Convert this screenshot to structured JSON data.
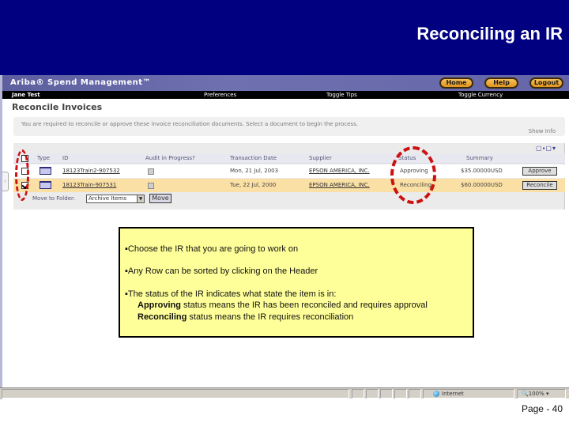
{
  "slide": {
    "title": "Reconciling an IR",
    "page_label": "Page - 40"
  },
  "app": {
    "brand": "Ariba® Spend Management™",
    "nav_buttons": [
      "Home",
      "Help",
      "Logout"
    ],
    "user": "Jane Test",
    "links": [
      "Preferences",
      "Toggle Tips",
      "Toggle Currency"
    ]
  },
  "page": {
    "title": "Reconcile Invoices",
    "message": "You are required to reconcile or approve these invoice reconciliation documents. Select a document to begin the process.",
    "show_link": "Show Info"
  },
  "table": {
    "tools": "▢▪▢▾",
    "headers": [
      "Type",
      "ID",
      "Audit in Progress?",
      "Transaction Date",
      "Supplier",
      "Status",
      "Summary"
    ],
    "rows": [
      {
        "checked": false,
        "id": "18123Train2-907532",
        "audit": false,
        "date": "Mon, 21 Jul, 2003",
        "supplier": "EPSON AMERICA, INC.",
        "status": "Approving",
        "summary": "$35.00000USD",
        "action": "Approve"
      },
      {
        "checked": true,
        "id": "18123Train-907531",
        "audit": false,
        "date": "Tue, 22 Jul, 2000",
        "supplier": "EPSON AMERICA, INC.",
        "status": "Reconciling",
        "summary": "$60.00000USD",
        "action": "Reconcile"
      }
    ],
    "move_label": "Move to Folder:",
    "move_select_value": "Archive Items",
    "move_button": "Move"
  },
  "callout": {
    "bullets": [
      "Choose the IR that you are going to work on",
      "Any Row can be sorted by clicking on the Header",
      "The status of the IR indicates what state the item is in:"
    ],
    "details": [
      {
        "term": "Approving",
        "text": " status means the IR has been reconciled and requires approval"
      },
      {
        "term": "Reconciling",
        "text": " status means the IR requires reconciliation"
      }
    ]
  },
  "status_bar": {
    "zone": "Internet",
    "zoom": "100%"
  },
  "colors": {
    "slide_header": "#000080",
    "highlight_row": "#fbe0a5",
    "callout_bg": "#ffff99",
    "annotation_red": "#cc1111"
  }
}
